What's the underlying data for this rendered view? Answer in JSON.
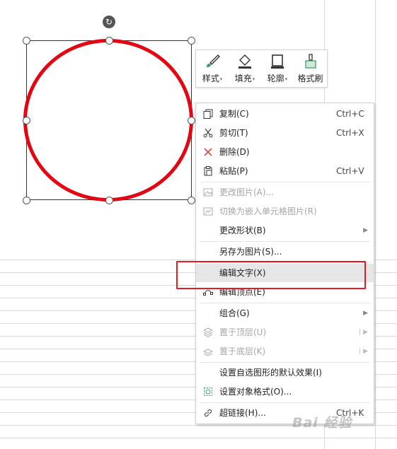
{
  "mini_toolbar": [
    {
      "label": "样式",
      "icon": "brush-style-icon"
    },
    {
      "label": "填充",
      "icon": "fill-bucket-icon"
    },
    {
      "label": "轮廓",
      "icon": "outline-icon"
    },
    {
      "label": "格式刷",
      "icon": "format-painter-icon"
    }
  ],
  "menu": {
    "copy": {
      "label": "复制(C)",
      "shortcut": "Ctrl+C",
      "icon": "copy-icon"
    },
    "cut": {
      "label": "剪切(T)",
      "shortcut": "Ctrl+X",
      "icon": "scissors-icon"
    },
    "delete": {
      "label": "删除(D)",
      "icon": "delete-x-icon"
    },
    "paste": {
      "label": "粘贴(P)",
      "shortcut": "Ctrl+V",
      "icon": "paste-icon"
    },
    "change_picture": {
      "label": "更改图片(A)...",
      "icon": "change-picture-icon",
      "disabled": true
    },
    "embed_cell": {
      "label": "切换为嵌入单元格图片(R)",
      "icon": "embed-cell-icon",
      "disabled": true
    },
    "change_shape": {
      "label": "更改形状(B)",
      "submenu": true
    },
    "save_as_picture": {
      "label": "另存为图片(S)..."
    },
    "edit_text": {
      "label": "编辑文字(X)"
    },
    "edit_points": {
      "label": "编辑顶点(E)",
      "icon": "edit-points-icon"
    },
    "group": {
      "label": "组合(G)",
      "submenu": true
    },
    "bring_front": {
      "label": "置于顶层(U)",
      "icon": "bring-front-icon",
      "disabled": true,
      "submenu": true
    },
    "send_back": {
      "label": "置于底层(K)",
      "icon": "send-back-icon",
      "disabled": true,
      "submenu": true
    },
    "set_default": {
      "label": "设置自选图形的默认效果(I)"
    },
    "format_object": {
      "label": "设置对象格式(O)...",
      "icon": "format-object-icon"
    },
    "hyperlink": {
      "label": "超链接(H)...",
      "shortcut": "Ctrl+K",
      "icon": "link-icon"
    }
  },
  "watermark": "Bai 经验",
  "colors": {
    "shape_outline": "#e30613",
    "annotation": "#e01f24",
    "hover": "#e6e6e6"
  }
}
